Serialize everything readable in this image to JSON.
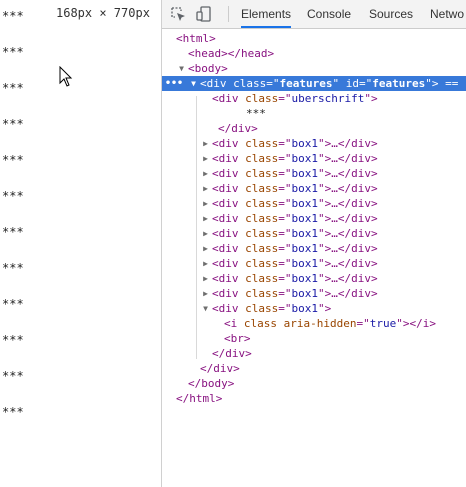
{
  "viewport": {
    "dimensions": "168px × 770px",
    "star_label": "***"
  },
  "devtools": {
    "tabs": [
      "Elements",
      "Console",
      "Sources",
      "Netwo"
    ],
    "active_tab": "Elements",
    "selected_suffix": "== $",
    "tree": {
      "html_open": "<html>",
      "head": "<head></head>",
      "body_open": "<body>",
      "features_tag": "div",
      "features_attr1": "class",
      "features_val1": "features",
      "features_attr2": "id",
      "features_val2": "features",
      "ueberschrift_tag": "div",
      "ueberschrift_attr": "class",
      "ueberschrift_val": "uberschrift",
      "ueberschrift_text": "***",
      "ueberschrift_close": "</div>",
      "box_tag": "div",
      "box_attr": "class",
      "box_val": "box1",
      "box_collapsed_tail": ">…</div>",
      "last_box_i_tag": "i",
      "last_box_i_attr1": "class",
      "last_box_i_attr2": "aria-hidden",
      "last_box_i_val2": "true",
      "last_box_br": "<br>",
      "last_box_close": "</div>",
      "features_close": "</div>",
      "body_close": "</body>",
      "html_close": "</html>"
    }
  }
}
